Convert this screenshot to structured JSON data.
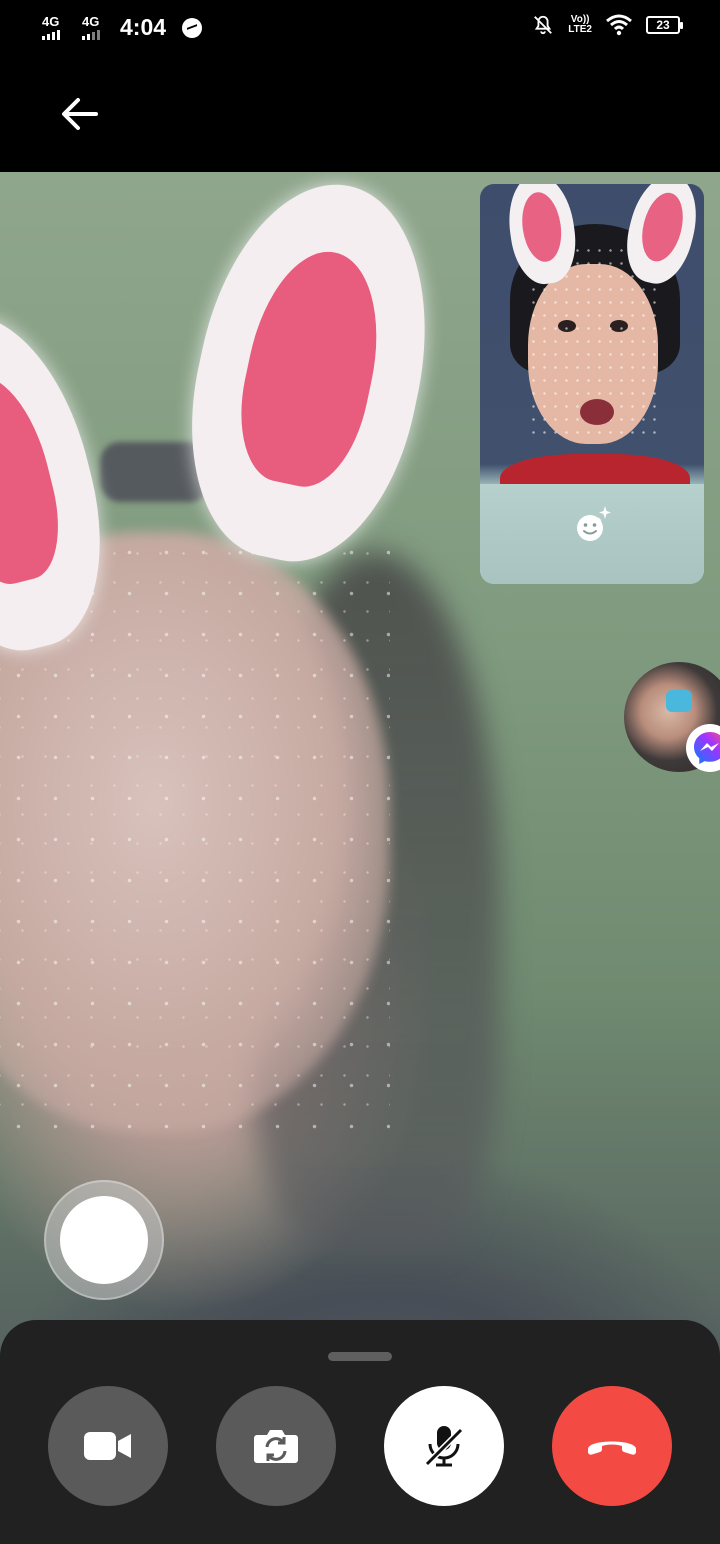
{
  "status_bar": {
    "network_1": "4G",
    "network_2": "4G",
    "time": "4:04",
    "volte_line1": "Vo))",
    "volte_line2": "LTE2",
    "battery": "23"
  },
  "icons": {
    "back": "arrow-left-icon",
    "effects": "face-effects-icon",
    "video": "video-camera-icon",
    "flip": "camera-flip-icon",
    "mic": "microphone-muted-icon",
    "end": "phone-hangup-icon",
    "messenger": "messenger-icon"
  },
  "colors": {
    "end_call": "#f44a44",
    "control_bg": "#212121",
    "control_button": "#5a5a5a",
    "messenger_gradient_start": "#0a7cff",
    "messenger_gradient_end": "#ff5280"
  }
}
